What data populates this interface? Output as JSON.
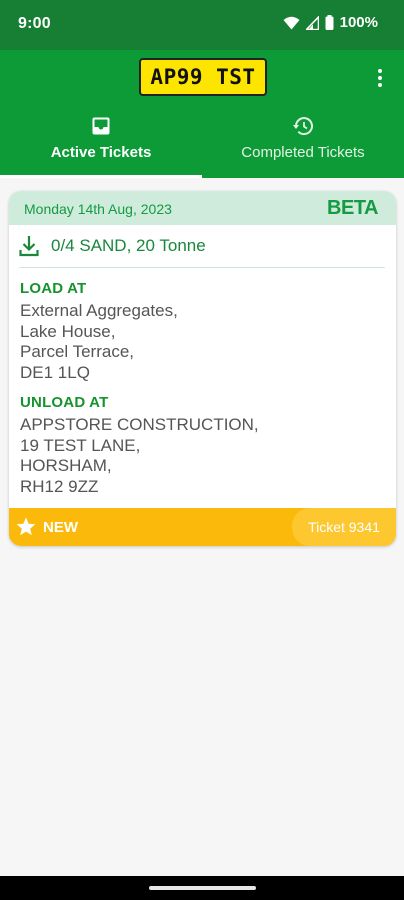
{
  "status_bar": {
    "time": "9:00",
    "battery_text": "100%",
    "icons": [
      "wifi-icon",
      "signal-icon",
      "battery-icon"
    ]
  },
  "app_bar": {
    "plate": "AP99 TST",
    "menu_icon": "more-vertical-icon"
  },
  "tabs": [
    {
      "label": "Active Tickets",
      "icon": "inbox-icon",
      "active": true
    },
    {
      "label": "Completed Tickets",
      "icon": "history-icon",
      "active": false
    }
  ],
  "ticket": {
    "date": "Monday 14th Aug, 2023",
    "badge": "BETA",
    "product": "0/4 SAND, 20 Tonne",
    "load_label": "LOAD AT",
    "load_address": [
      "External Aggregates,",
      "Lake House,",
      "Parcel Terrace,",
      "DE1 1LQ"
    ],
    "unload_label": "UNLOAD AT",
    "unload_address": [
      "APPSTORE CONSTRUCTION,",
      "19 TEST LANE,",
      "HORSHAM,",
      "RH12 9ZZ"
    ],
    "status": "NEW",
    "ticket_number": "Ticket 9341"
  },
  "colors": {
    "status_bar": "#167f33",
    "app_bar": "#0d9b38",
    "plate": "#fde500",
    "accent_green": "#169a42",
    "header_tint": "#cfebdb",
    "footer_amber": "#fbba0b"
  }
}
